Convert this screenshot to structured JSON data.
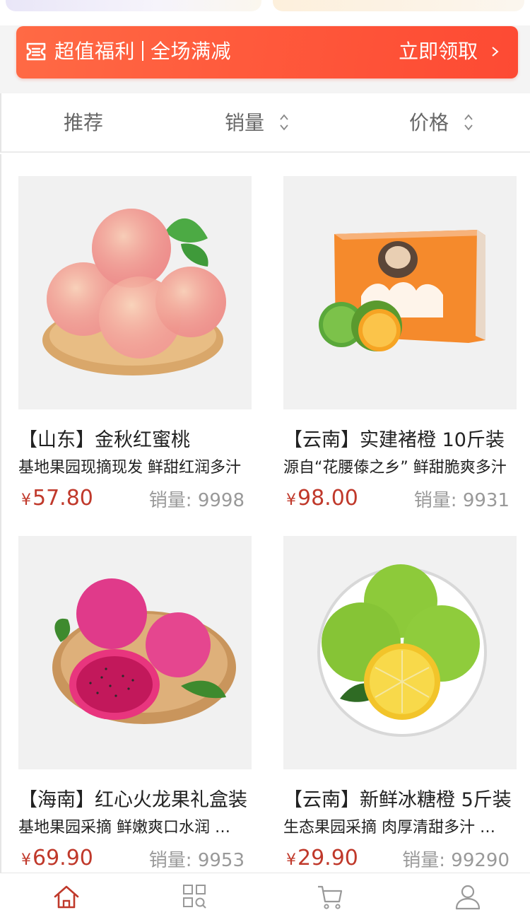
{
  "promo": {
    "left_label": "超值福利",
    "right_label": "全场满减",
    "cta": "立即领取",
    "icon": "coupon-icon"
  },
  "sort": {
    "recommend": "推荐",
    "sales": "销量",
    "price": "价格"
  },
  "products": [
    {
      "title": "【山东】金秋红蜜桃",
      "desc": "基地果园现摘现发 鲜甜红润多汁",
      "currency": "¥",
      "price": "57.80",
      "sold_label": "销量:",
      "sold": "9998",
      "image": "peach"
    },
    {
      "title": "【云南】实建褚橙 10斤装",
      "desc": "源自“花腰傣之乡” 鲜甜脆爽多汁",
      "currency": "¥",
      "price": "98.00",
      "sold_label": "销量:",
      "sold": "9931",
      "image": "orange-box"
    },
    {
      "title": "【海南】红心火龙果礼盒装",
      "desc": "基地果园采摘 鲜嫩爽口水润 香甜",
      "currency": "¥",
      "price": "69.90",
      "sold_label": "销量:",
      "sold": "9953",
      "image": "dragon-fruit"
    },
    {
      "title": "【云南】新鲜冰糖橙 5斤装",
      "desc": "生态果园采摘 肉厚清甜多汁 皮薄",
      "currency": "¥",
      "price": "29.90",
      "sold_label": "销量:",
      "sold": "99290",
      "image": "green-orange"
    }
  ],
  "tabbar": {
    "tabs": [
      {
        "icon": "home-icon",
        "active": true
      },
      {
        "icon": "category-search-icon",
        "active": false
      },
      {
        "icon": "cart-icon",
        "active": false
      },
      {
        "icon": "user-icon",
        "active": false
      }
    ],
    "active_color": "#c0392b",
    "inactive_color": "#999999"
  },
  "colors": {
    "brand": "#ff5a3c",
    "price": "#c0392b"
  }
}
